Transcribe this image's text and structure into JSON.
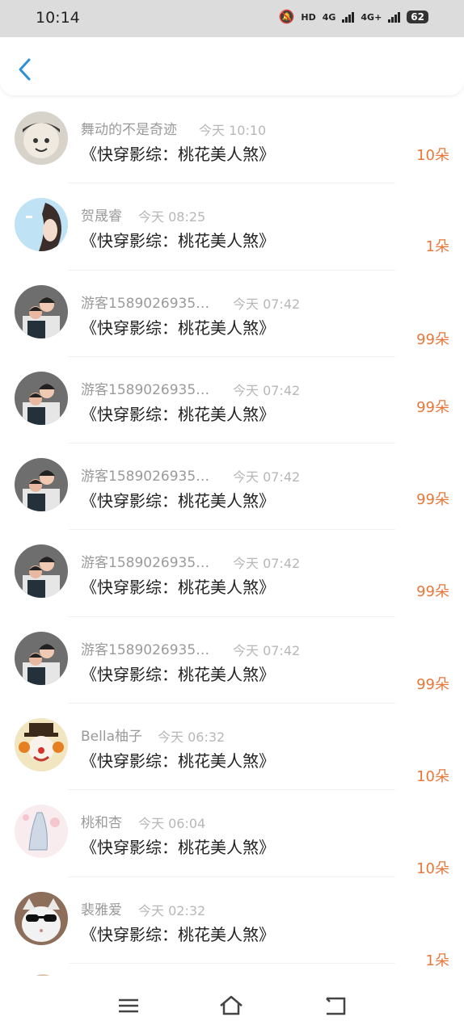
{
  "status_bar": {
    "time": "10:14",
    "hd_label": "HD",
    "net1": "4G",
    "net2": "4G+",
    "battery": "62"
  },
  "header": {
    "back_icon": "chevron-left-icon",
    "accent": "#2b8fd9"
  },
  "colors": {
    "flowers": "#e8773a"
  },
  "rows": [
    {
      "name": "舞动的不是奇迹",
      "time": "今天 10:10",
      "title": "《快穿影综：桃花美人煞》",
      "flowers": "10朵",
      "avatar": "cartoon-boy"
    },
    {
      "name": "贺晟睿",
      "time": "今天 08:25",
      "title": "《快穿影综：桃花美人煞》",
      "flowers": "1朵",
      "avatar": "girl-sky"
    },
    {
      "name": "游客1589026935…",
      "time": "今天 07:42",
      "title": "《快穿影综：桃花美人煞》",
      "flowers": "99朵",
      "avatar": "couple"
    },
    {
      "name": "游客1589026935…",
      "time": "今天 07:42",
      "title": "《快穿影综：桃花美人煞》",
      "flowers": "99朵",
      "avatar": "couple"
    },
    {
      "name": "游客1589026935…",
      "time": "今天 07:42",
      "title": "《快穿影综：桃花美人煞》",
      "flowers": "99朵",
      "avatar": "couple"
    },
    {
      "name": "游客1589026935…",
      "time": "今天 07:42",
      "title": "《快穿影综：桃花美人煞》",
      "flowers": "99朵",
      "avatar": "couple"
    },
    {
      "name": "游客1589026935…",
      "time": "今天 07:42",
      "title": "《快穿影综：桃花美人煞》",
      "flowers": "99朵",
      "avatar": "couple"
    },
    {
      "name": "Bella柚子",
      "time": "今天 06:32",
      "title": "《快穿影综：桃花美人煞》",
      "flowers": "10朵",
      "avatar": "clown"
    },
    {
      "name": "桃和杏",
      "time": "今天 06:04",
      "title": "《快穿影综：桃花美人煞》",
      "flowers": "10朵",
      "avatar": "sketch"
    },
    {
      "name": "裴雅爱",
      "time": "今天 02:32",
      "title": "《快穿影综：桃花美人煞》",
      "flowers": "1朵",
      "avatar": "cat-sunglasses"
    }
  ],
  "nav": {
    "menu_icon": "menu-icon",
    "home_icon": "home-icon",
    "back_icon": "back-icon"
  }
}
